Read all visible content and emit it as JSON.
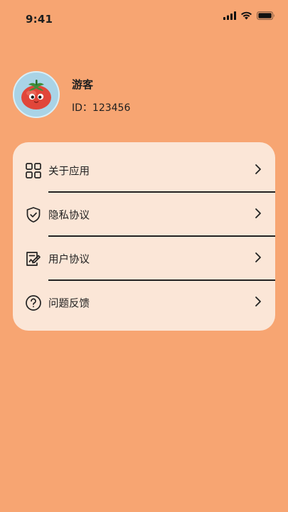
{
  "status_bar": {
    "time": "9:41",
    "icons": [
      "signal-icon",
      "wifi-icon",
      "battery-icon"
    ]
  },
  "profile": {
    "avatar_icon": "tomato-avatar-icon",
    "username": "游客",
    "user_id": "ID：123456"
  },
  "menu": {
    "items": [
      {
        "label": "关于应用",
        "icon": "grid-icon"
      },
      {
        "label": "隐私协议",
        "icon": "shield-check-icon"
      },
      {
        "label": "用户协议",
        "icon": "document-edit-icon"
      },
      {
        "label": "问题反馈",
        "icon": "question-circle-icon"
      }
    ]
  },
  "colors": {
    "background": "#F7A572",
    "card": "#FBE6D7",
    "avatar_bg": "#A9D3E6"
  }
}
